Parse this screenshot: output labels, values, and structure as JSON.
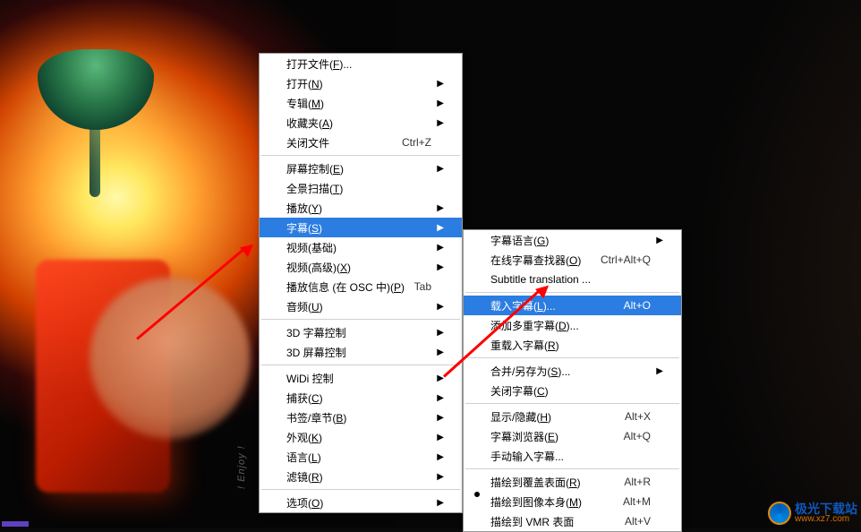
{
  "mainMenu": {
    "items": [
      {
        "label": "打开文件(F)...",
        "hasArrow": false
      },
      {
        "label": "打开(N)",
        "hasArrow": true
      },
      {
        "label": "专辑(M)",
        "hasArrow": true
      },
      {
        "label": "收藏夹(A)",
        "hasArrow": true
      },
      {
        "label": "关闭文件",
        "shortcut": "Ctrl+Z"
      },
      {
        "sep": true
      },
      {
        "label": "屏幕控制(E)",
        "hasArrow": true
      },
      {
        "label": "全景扫描(T)"
      },
      {
        "label": "播放(Y)",
        "hasArrow": true
      },
      {
        "label": "字幕(S)",
        "hasArrow": true,
        "highlight": true
      },
      {
        "label": "视频(基础)",
        "hasArrow": true
      },
      {
        "label": "视频(高级)(X)",
        "hasArrow": true
      },
      {
        "label": "播放信息 (在 OSC 中)(P)",
        "shortcut": "Tab"
      },
      {
        "label": "音频(U)",
        "hasArrow": true
      },
      {
        "sep": true
      },
      {
        "label": "3D 字幕控制",
        "hasArrow": true
      },
      {
        "label": "3D 屏幕控制",
        "hasArrow": true
      },
      {
        "sep": true
      },
      {
        "label": "WiDi 控制",
        "hasArrow": true
      },
      {
        "label": "捕获(C)",
        "hasArrow": true
      },
      {
        "label": "书签/章节(B)",
        "hasArrow": true
      },
      {
        "label": "外观(K)",
        "hasArrow": true
      },
      {
        "label": "语言(L)",
        "hasArrow": true
      },
      {
        "label": "滤镜(R)",
        "hasArrow": true
      },
      {
        "sep": true
      },
      {
        "label": "选项(O)",
        "hasArrow": true
      }
    ]
  },
  "subMenu": {
    "items": [
      {
        "label": "字幕语言(G)",
        "hasArrow": true
      },
      {
        "label": "在线字幕查找器(O)",
        "shortcut": "Ctrl+Alt+Q"
      },
      {
        "label": "Subtitle translation ..."
      },
      {
        "sep": true
      },
      {
        "label": "载入字幕(L)...",
        "shortcut": "Alt+O",
        "highlight": true
      },
      {
        "label": "添加多重字幕(D)..."
      },
      {
        "label": "重载入字幕(R)"
      },
      {
        "sep": true
      },
      {
        "label": "合并/另存为(S)...",
        "hasArrow": true
      },
      {
        "label": "关闭字幕(C)"
      },
      {
        "sep": true
      },
      {
        "label": "显示/隐藏(H)",
        "shortcut": "Alt+X"
      },
      {
        "label": "字幕浏览器(E)",
        "shortcut": "Alt+Q"
      },
      {
        "label": "手动输入字幕..."
      },
      {
        "sep": true
      },
      {
        "label": "描绘到覆盖表面(R)",
        "shortcut": "Alt+R"
      },
      {
        "label": "描绘到图像本身(M)",
        "shortcut": "Alt+M",
        "radio": true
      },
      {
        "label": "描绘到 VMR 表面",
        "shortcut": "Alt+V"
      }
    ]
  },
  "watermark": {
    "cn": "极光下载站",
    "url": "www.xz7.com"
  },
  "enjoy": "! Enjoy !"
}
